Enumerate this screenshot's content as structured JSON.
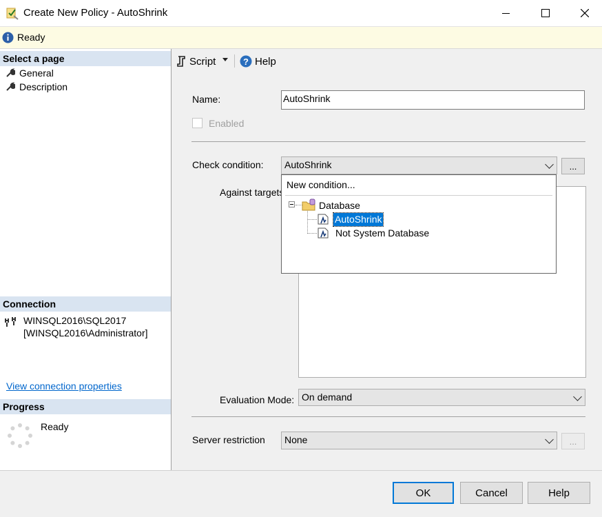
{
  "window": {
    "title": "Create New Policy - AutoShrink",
    "minimize_glyph": "—",
    "maximize_glyph": "☐",
    "close_glyph": "✕"
  },
  "status": {
    "text": "Ready"
  },
  "left": {
    "select_page_header": "Select a page",
    "pages": [
      {
        "label": "General",
        "icon": "wrench-icon"
      },
      {
        "label": "Description",
        "icon": "wrench-icon"
      }
    ],
    "connection_header": "Connection",
    "connection_server": "WINSQL2016\\SQL2017",
    "connection_user": "[WINSQL2016\\Administrator]",
    "view_connection_link": "View connection properties",
    "progress_header": "Progress",
    "progress_status": "Ready"
  },
  "toolbar": {
    "script_label": "Script",
    "help_label": "Help"
  },
  "form": {
    "name_label": "Name:",
    "name_value": "AutoShrink",
    "enabled_label": "Enabled",
    "enabled_checked": false,
    "check_condition_label": "Check condition:",
    "check_condition_value": "AutoShrink",
    "ellipsis": "...",
    "against_targets_label": "Against targets",
    "evaluation_mode_label": "Evaluation Mode:",
    "evaluation_mode_value": "On demand",
    "server_restriction_label": "Server restriction",
    "server_restriction_value": "None"
  },
  "dropdown": {
    "new_condition": "New condition...",
    "tree_root": "Database",
    "tree_items": [
      "AutoShrink",
      "Not System Database"
    ],
    "selected_item": "AutoShrink"
  },
  "buttons": {
    "ok": "OK",
    "cancel": "Cancel",
    "help": "Help"
  },
  "colors": {
    "accent": "#0078d7",
    "link": "#0066cc",
    "section_header": "#d9e4f1",
    "status_bg": "#fdfbe3"
  }
}
